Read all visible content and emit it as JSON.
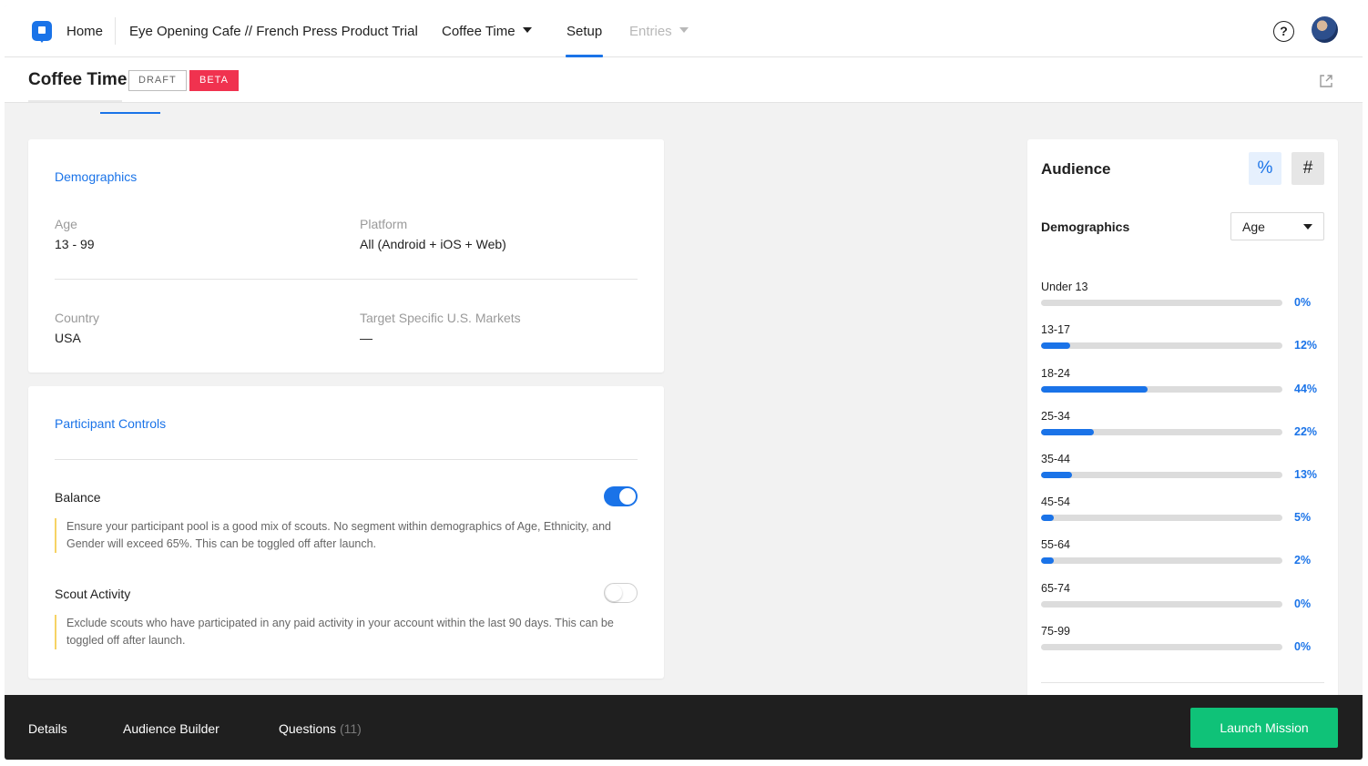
{
  "nav": {
    "home": "Home",
    "breadcrumb": "Eye Opening Cafe // French Press Product Trial",
    "mission": "Coffee Time",
    "setup": "Setup",
    "entries": "Entries"
  },
  "subheader": {
    "title": "Coffee Time",
    "badge_draft": "DRAFT",
    "badge_beta": "BETA"
  },
  "demographics": {
    "heading": "Demographics",
    "fields": [
      {
        "label": "Age",
        "value": "13 - 99"
      },
      {
        "label": "Platform",
        "value": "All (Android + iOS + Web)"
      },
      {
        "label": "Country",
        "value": "USA"
      },
      {
        "label": "Target Specific U.S. Markets",
        "value": "—"
      }
    ]
  },
  "participant_controls": {
    "heading": "Participant Controls",
    "items": [
      {
        "label": "Balance",
        "enabled": true,
        "description": "Ensure your participant pool is a good mix of scouts. No segment within demographics of Age, Ethnicity, and Gender will exceed 65%. This can be toggled off after launch."
      },
      {
        "label": "Scout Activity",
        "enabled": false,
        "description": "Exclude scouts who have participated in any paid activity in your account within the last 90 days. This can be toggled off after launch."
      }
    ]
  },
  "audience": {
    "title": "Audience",
    "percent_button": "%",
    "count_button": "#",
    "demographics_label": "Demographics",
    "selected_dimension": "Age",
    "accent_color": "#1a73e8",
    "bars": [
      {
        "label": "Under 13",
        "value": 0,
        "display": "0%"
      },
      {
        "label": "13-17",
        "value": 12,
        "display": "12%"
      },
      {
        "label": "18-24",
        "value": 44,
        "display": "44%"
      },
      {
        "label": "25-34",
        "value": 22,
        "display": "22%"
      },
      {
        "label": "35-44",
        "value": 13,
        "display": "13%"
      },
      {
        "label": "45-54",
        "value": 5,
        "display": "5%"
      },
      {
        "label": "55-64",
        "value": 2,
        "display": "2%"
      },
      {
        "label": "65-74",
        "value": 0,
        "display": "0%"
      },
      {
        "label": "75-99",
        "value": 0,
        "display": "0%"
      }
    ]
  },
  "footer": {
    "details": "Details",
    "audience_builder": "Audience Builder",
    "questions": "Questions",
    "questions_count": "(11)",
    "launch": "Launch Mission",
    "launch_color": "#0fc278"
  }
}
